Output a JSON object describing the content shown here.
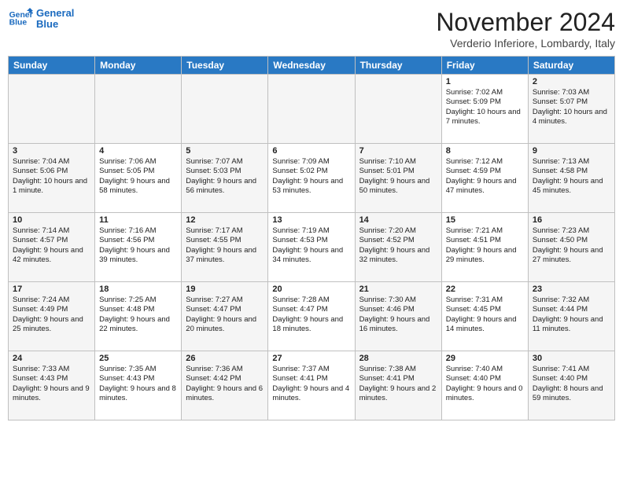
{
  "header": {
    "logo_line1": "General",
    "logo_line2": "Blue",
    "month": "November 2024",
    "location": "Verderio Inferiore, Lombardy, Italy"
  },
  "weekdays": [
    "Sunday",
    "Monday",
    "Tuesday",
    "Wednesday",
    "Thursday",
    "Friday",
    "Saturday"
  ],
  "weeks": [
    [
      {
        "day": "",
        "info": ""
      },
      {
        "day": "",
        "info": ""
      },
      {
        "day": "",
        "info": ""
      },
      {
        "day": "",
        "info": ""
      },
      {
        "day": "",
        "info": ""
      },
      {
        "day": "1",
        "info": "Sunrise: 7:02 AM\nSunset: 5:09 PM\nDaylight: 10 hours and 7 minutes."
      },
      {
        "day": "2",
        "info": "Sunrise: 7:03 AM\nSunset: 5:07 PM\nDaylight: 10 hours and 4 minutes."
      }
    ],
    [
      {
        "day": "3",
        "info": "Sunrise: 7:04 AM\nSunset: 5:06 PM\nDaylight: 10 hours and 1 minute."
      },
      {
        "day": "4",
        "info": "Sunrise: 7:06 AM\nSunset: 5:05 PM\nDaylight: 9 hours and 58 minutes."
      },
      {
        "day": "5",
        "info": "Sunrise: 7:07 AM\nSunset: 5:03 PM\nDaylight: 9 hours and 56 minutes."
      },
      {
        "day": "6",
        "info": "Sunrise: 7:09 AM\nSunset: 5:02 PM\nDaylight: 9 hours and 53 minutes."
      },
      {
        "day": "7",
        "info": "Sunrise: 7:10 AM\nSunset: 5:01 PM\nDaylight: 9 hours and 50 minutes."
      },
      {
        "day": "8",
        "info": "Sunrise: 7:12 AM\nSunset: 4:59 PM\nDaylight: 9 hours and 47 minutes."
      },
      {
        "day": "9",
        "info": "Sunrise: 7:13 AM\nSunset: 4:58 PM\nDaylight: 9 hours and 45 minutes."
      }
    ],
    [
      {
        "day": "10",
        "info": "Sunrise: 7:14 AM\nSunset: 4:57 PM\nDaylight: 9 hours and 42 minutes."
      },
      {
        "day": "11",
        "info": "Sunrise: 7:16 AM\nSunset: 4:56 PM\nDaylight: 9 hours and 39 minutes."
      },
      {
        "day": "12",
        "info": "Sunrise: 7:17 AM\nSunset: 4:55 PM\nDaylight: 9 hours and 37 minutes."
      },
      {
        "day": "13",
        "info": "Sunrise: 7:19 AM\nSunset: 4:53 PM\nDaylight: 9 hours and 34 minutes."
      },
      {
        "day": "14",
        "info": "Sunrise: 7:20 AM\nSunset: 4:52 PM\nDaylight: 9 hours and 32 minutes."
      },
      {
        "day": "15",
        "info": "Sunrise: 7:21 AM\nSunset: 4:51 PM\nDaylight: 9 hours and 29 minutes."
      },
      {
        "day": "16",
        "info": "Sunrise: 7:23 AM\nSunset: 4:50 PM\nDaylight: 9 hours and 27 minutes."
      }
    ],
    [
      {
        "day": "17",
        "info": "Sunrise: 7:24 AM\nSunset: 4:49 PM\nDaylight: 9 hours and 25 minutes."
      },
      {
        "day": "18",
        "info": "Sunrise: 7:25 AM\nSunset: 4:48 PM\nDaylight: 9 hours and 22 minutes."
      },
      {
        "day": "19",
        "info": "Sunrise: 7:27 AM\nSunset: 4:47 PM\nDaylight: 9 hours and 20 minutes."
      },
      {
        "day": "20",
        "info": "Sunrise: 7:28 AM\nSunset: 4:47 PM\nDaylight: 9 hours and 18 minutes."
      },
      {
        "day": "21",
        "info": "Sunrise: 7:30 AM\nSunset: 4:46 PM\nDaylight: 9 hours and 16 minutes."
      },
      {
        "day": "22",
        "info": "Sunrise: 7:31 AM\nSunset: 4:45 PM\nDaylight: 9 hours and 14 minutes."
      },
      {
        "day": "23",
        "info": "Sunrise: 7:32 AM\nSunset: 4:44 PM\nDaylight: 9 hours and 11 minutes."
      }
    ],
    [
      {
        "day": "24",
        "info": "Sunrise: 7:33 AM\nSunset: 4:43 PM\nDaylight: 9 hours and 9 minutes."
      },
      {
        "day": "25",
        "info": "Sunrise: 7:35 AM\nSunset: 4:43 PM\nDaylight: 9 hours and 8 minutes."
      },
      {
        "day": "26",
        "info": "Sunrise: 7:36 AM\nSunset: 4:42 PM\nDaylight: 9 hours and 6 minutes."
      },
      {
        "day": "27",
        "info": "Sunrise: 7:37 AM\nSunset: 4:41 PM\nDaylight: 9 hours and 4 minutes."
      },
      {
        "day": "28",
        "info": "Sunrise: 7:38 AM\nSunset: 4:41 PM\nDaylight: 9 hours and 2 minutes."
      },
      {
        "day": "29",
        "info": "Sunrise: 7:40 AM\nSunset: 4:40 PM\nDaylight: 9 hours and 0 minutes."
      },
      {
        "day": "30",
        "info": "Sunrise: 7:41 AM\nSunset: 4:40 PM\nDaylight: 8 hours and 59 minutes."
      }
    ]
  ]
}
